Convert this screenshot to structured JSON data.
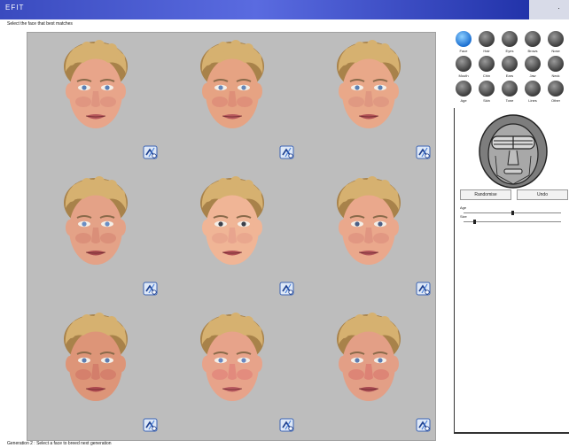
{
  "window": {
    "title": "EFIT",
    "title_right": "·"
  },
  "instruction": "Select the face that best matches",
  "grid": {
    "cells": [
      {
        "skin": "#e8a58a",
        "cheek": "#d98a7a",
        "eye": "#5a7fb5",
        "lip": "#b5565a"
      },
      {
        "skin": "#e6a383",
        "cheek": "#d88272",
        "eye": "#6687b8",
        "lip": "#b7585c"
      },
      {
        "skin": "#e9a889",
        "cheek": "#d98c7b",
        "eye": "#5b80b2",
        "lip": "#b05054"
      },
      {
        "skin": "#e4a287",
        "cheek": "#d48270",
        "eye": "#6a8ec4",
        "lip": "#a84a4e"
      },
      {
        "skin": "#f0b596",
        "cheek": "#e39a88",
        "eye": "#3a3f4a",
        "lip": "#b04f55"
      },
      {
        "skin": "#eaa88c",
        "cheek": "#d9897a",
        "eye": "#4a5f86",
        "lip": "#b1545a"
      },
      {
        "skin": "#dd9578",
        "cheek": "#cd6f63",
        "eye": "#5d7db0",
        "lip": "#ae4a50"
      },
      {
        "skin": "#e7a38a",
        "cheek": "#e07a75",
        "eye": "#6a88c0",
        "lip": "#b85a60"
      },
      {
        "skin": "#e39f86",
        "cheek": "#d8706a",
        "eye": "#5c7cb0",
        "lip": "#a84a52"
      }
    ],
    "hair_color": "#d6b170",
    "hair_shadow": "#a8824a",
    "background": "#bdbdbd"
  },
  "features": {
    "items": [
      {
        "label": "Face",
        "active": true
      },
      {
        "label": "Hair",
        "active": false
      },
      {
        "label": "Eyes",
        "active": false
      },
      {
        "label": "Brows",
        "active": false
      },
      {
        "label": "Nose",
        "active": false
      },
      {
        "label": "Mouth",
        "active": false
      },
      {
        "label": "Chin",
        "active": false
      },
      {
        "label": "Ears",
        "active": false
      },
      {
        "label": "Jaw",
        "active": false
      },
      {
        "label": "Neck",
        "active": false
      },
      {
        "label": "Age",
        "active": false
      },
      {
        "label": "Skin",
        "active": false
      },
      {
        "label": "Tone",
        "active": false
      },
      {
        "label": "Lines",
        "active": false
      },
      {
        "label": "Other",
        "active": false
      }
    ]
  },
  "editor": {
    "left_button": "Randomise",
    "right_button": "Undo",
    "sliders": [
      {
        "label": "Age",
        "value": 0.5
      },
      {
        "label": "Size",
        "value": 0.1
      }
    ]
  },
  "status": "Generation 2 : Select a face to breed next generation"
}
